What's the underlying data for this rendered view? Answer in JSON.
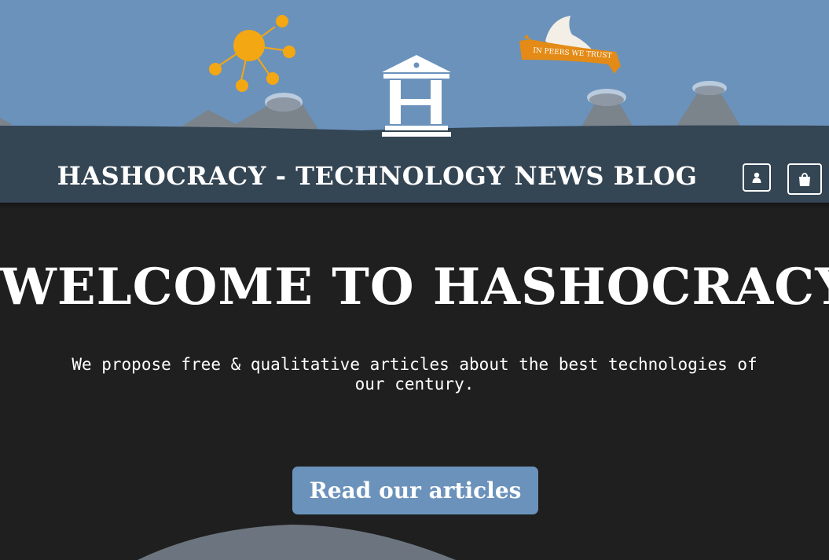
{
  "header": {
    "site_title": "HASHOCRACY - TECHNOLOGY NEWS BLOG",
    "banner_text": "IN PEERS WE TRUST",
    "account_icon": "user-icon",
    "cart_icon": "shopping-bag-icon"
  },
  "hero": {
    "title": "WELCOME TO HASHOCRACY",
    "subtitle": "We propose free & qualitative articles about the best technologies of our century.",
    "cta_label": "Read our articles"
  },
  "colors": {
    "sky": "#6b92bb",
    "navbar": "#344554",
    "background": "#1f1f1f",
    "sun": "#f3a712",
    "banner": "#e38b16",
    "button": "#6b92bb"
  }
}
